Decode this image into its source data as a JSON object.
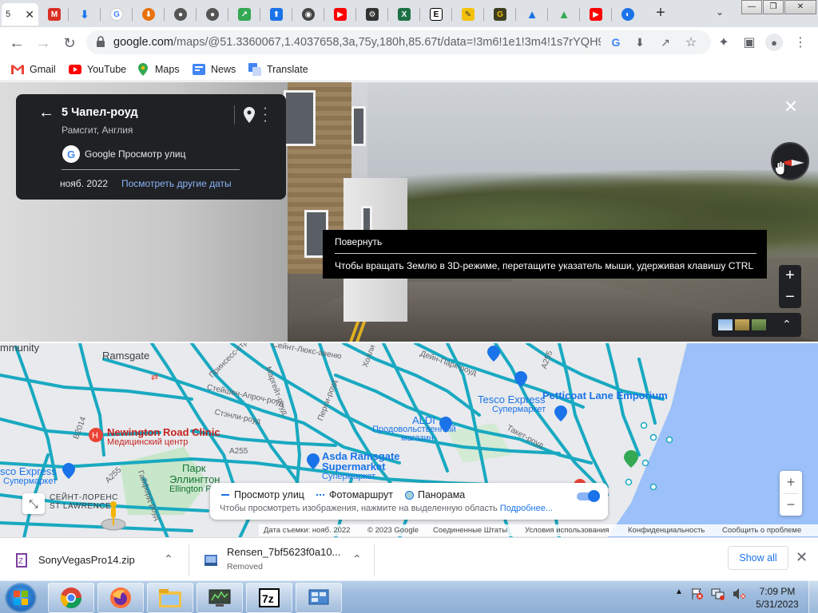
{
  "browser": {
    "active_tab_label": "5",
    "tab_favicons": [
      "gmail-icon",
      "download-icon",
      "google-icon",
      "download-orange-icon",
      "github-icon",
      "github-icon",
      "share-icon",
      "upload-icon",
      "chrome-icon",
      "youtube-icon",
      "tool-icon",
      "excel-icon",
      "extension-icon",
      "pencil-icon",
      "goodreads-icon",
      "drive-icon",
      "drive-icon",
      "youtube-icon",
      "app-icon"
    ],
    "url_host": "google.com",
    "url_path": "/maps/@51.3360067,1.4037658,3a,75y,180h,85.67t/data=!3m6!1e1!3m4!1s7rYQH9Gf...",
    "bookmarks": [
      {
        "label": "Gmail",
        "icon": "gmail-icon"
      },
      {
        "label": "YouTube",
        "icon": "youtube-icon"
      },
      {
        "label": "Maps",
        "icon": "maps-icon"
      },
      {
        "label": "News",
        "icon": "news-icon"
      },
      {
        "label": "Translate",
        "icon": "translate-icon"
      }
    ]
  },
  "street_view": {
    "title": "5 Чапел-роуд",
    "subtitle": "Рамсгит, Англия",
    "provider": "Google Просмотр улиц",
    "date": "нояб. 2022",
    "more_dates": "Посмотреть другие даты",
    "tooltip_title": "Повернуть",
    "tooltip_body": "Чтобы вращать Землю в 3D-режиме, перетащите указатель мыши, удерживая клавишу CTRL",
    "zoom_in": "+",
    "zoom_out": "−"
  },
  "map": {
    "labels": {
      "community": "mmunity",
      "ramsgate": "Ramsgate",
      "newington": "Newington Road Clinic",
      "newington_sub": "Медицинский центр",
      "tesco_top": "Tesco Express",
      "tesco_top_sub": "Супермаркет",
      "petticoat": "Petticoat Lane Emporium",
      "aldi": "ALDI",
      "aldi_sub1": "Продовольственный",
      "aldi_sub2": "магазин",
      "asda1": "Asda Ramsgate",
      "asda2": "Supermarket",
      "asda_sub": "Супермаркет",
      "tesco_left": "sco Express",
      "tesco_left_sub": "Супермаркет",
      "park1": "Парк",
      "park2": "Эллингтон",
      "park3": "Ellington Pa",
      "stlaw1": "СЕЙНТ-ЛОРЕНС",
      "stlaw2": "ST LAWRENCE",
      "b2014": "B2014",
      "a255a": "A255",
      "a255b": "A255",
      "a255c": "A255",
      "margate_rd": "Маргейт-роуд",
      "perci_rd": "Перси-роуд",
      "prinsess": "Принсесс-стрит",
      "stanley": "Стейшен-Апроч-роуд",
      "stanly_rd": "Стэнли-роуд",
      "hollybush": "Холли",
      "deyn": "Дейн-Парк-роуд",
      "saint_luke": "Сейнт-Люкс-авеню",
      "takker": "Такет-роуд",
      "alexandra": "Гайфорд-роуд"
    },
    "layer_panel": {
      "street_view": "Просмотр улиц",
      "photo_route": "Фотомаршрут",
      "panorama": "Панорама",
      "hint": "Чтобы просмотреть изображения, нажмите на выделенную область",
      "more": "Подробнее..."
    },
    "zoom_in": "+",
    "zoom_out": "−",
    "attribution": {
      "date": "Дата съемки: нояб. 2022",
      "copyright": "© 2023 Google",
      "country": "Соединенные Штаты",
      "terms": "Условия использования",
      "privacy": "Конфиденциальность",
      "report": "Сообщить о проблеме"
    }
  },
  "downloads": [
    {
      "name": "SonyVegasPro14.zip",
      "status": "",
      "icon": "winrar-icon"
    },
    {
      "name": "Rensen_7bf5623f0a10...",
      "status": "Removed",
      "icon": "file-icon"
    }
  ],
  "downloads_show_all": "Show all",
  "taskbar": {
    "apps": [
      "chrome-icon",
      "firefox-icon",
      "explorer-icon",
      "monitor-icon",
      "7zip-icon",
      "control-panel-icon"
    ],
    "time": "7:09 PM",
    "date": "5/31/2023"
  },
  "colors": {
    "map_roads": "#19a9c1",
    "map_water": "#9cc0f9",
    "accent": "#1a73e8"
  }
}
